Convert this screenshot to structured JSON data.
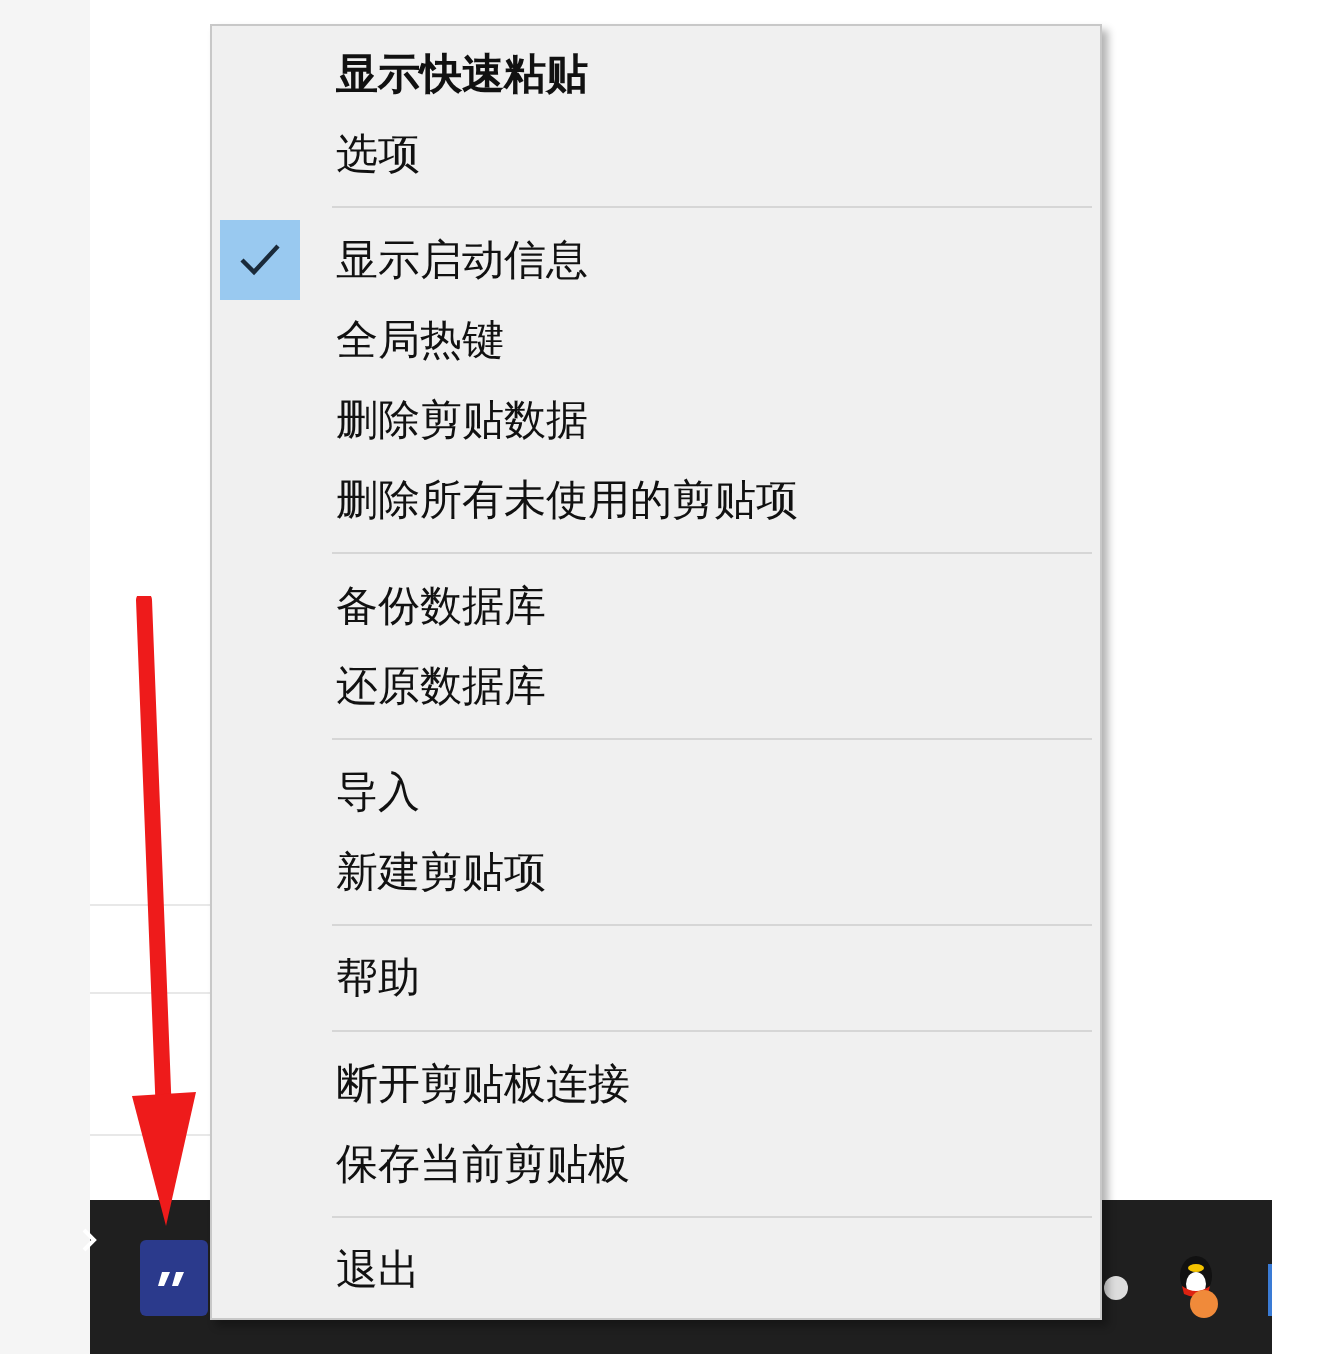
{
  "context_menu": {
    "groups": [
      {
        "items": [
          {
            "label": "显示快速粘贴",
            "default": true,
            "checked": false
          },
          {
            "label": "选项",
            "default": false,
            "checked": false
          }
        ]
      },
      {
        "items": [
          {
            "label": "显示启动信息",
            "default": false,
            "checked": true
          },
          {
            "label": "全局热键",
            "default": false,
            "checked": false
          },
          {
            "label": "删除剪贴数据",
            "default": false,
            "checked": false
          },
          {
            "label": "删除所有未使用的剪贴项",
            "default": false,
            "checked": false
          }
        ]
      },
      {
        "items": [
          {
            "label": "备份数据库",
            "default": false,
            "checked": false
          },
          {
            "label": "还原数据库",
            "default": false,
            "checked": false
          }
        ]
      },
      {
        "items": [
          {
            "label": "导入",
            "default": false,
            "checked": false
          },
          {
            "label": "新建剪贴项",
            "default": false,
            "checked": false
          }
        ]
      },
      {
        "items": [
          {
            "label": "帮助",
            "default": false,
            "checked": false
          }
        ]
      },
      {
        "items": [
          {
            "label": "断开剪贴板连接",
            "default": false,
            "checked": false
          },
          {
            "label": "保存当前剪贴板",
            "default": false,
            "checked": false
          }
        ]
      },
      {
        "items": [
          {
            "label": "退出",
            "default": false,
            "checked": false
          }
        ]
      }
    ]
  }
}
